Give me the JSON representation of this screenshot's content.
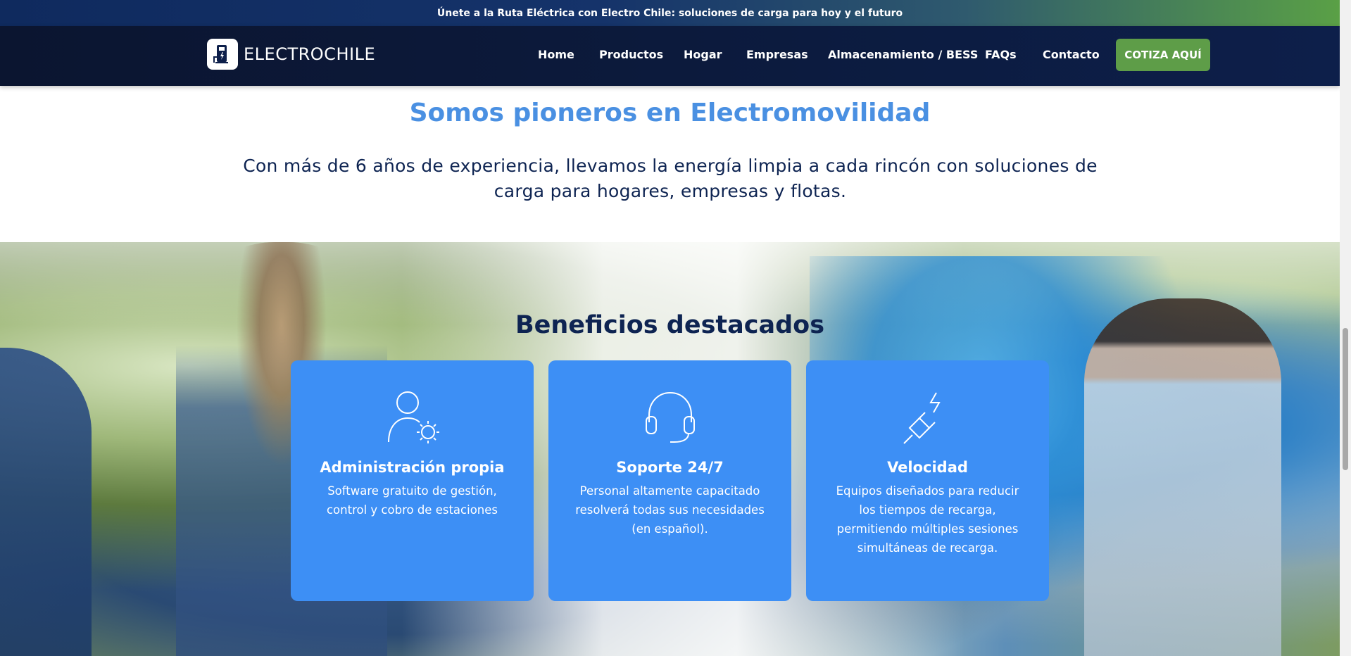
{
  "announcement": "Únete a la Ruta Eléctrica con Electro Chile: soluciones de carga para hoy y el futuro",
  "brand": {
    "name": "ELECTROCHILE",
    "logo_icon": "ev-charger-icon"
  },
  "nav": {
    "items": [
      {
        "label": "Home"
      },
      {
        "label": "Productos"
      },
      {
        "label": "Hogar"
      },
      {
        "label": "Empresas"
      },
      {
        "label": "Almacenamiento / BESS"
      },
      {
        "label": "FAQs"
      },
      {
        "label": "Contacto"
      }
    ],
    "cta_label": "COTIZA AQUÍ"
  },
  "intro": {
    "title": "Somos pioneros en Electromovilidad",
    "text": "Con más de 6 años de experiencia, llevamos la energía limpia a cada rincón con soluciones de carga para hogares, empresas y flotas."
  },
  "benefits": {
    "title": "Beneficios destacados",
    "cards": [
      {
        "icon": "user-gear-icon",
        "title": "Administración propia",
        "text": "Software gratuito de gestión, control y cobro de estaciones"
      },
      {
        "icon": "headset-icon",
        "title": "Soporte 24/7",
        "text": "Personal altamente capacitado resolverá todas sus necesidades (en español)."
      },
      {
        "icon": "plug-lightning-icon",
        "title": "Velocidad",
        "text": "Equipos diseñados para reducir los tiempos de recarga, permitiendo múltiples sesiones simultáneas de recarga."
      }
    ]
  },
  "colors": {
    "accent_blue": "#3d8ff5",
    "title_blue": "#4a90e2",
    "navy": "#0e2452",
    "cta_green": "#5e9d48"
  }
}
